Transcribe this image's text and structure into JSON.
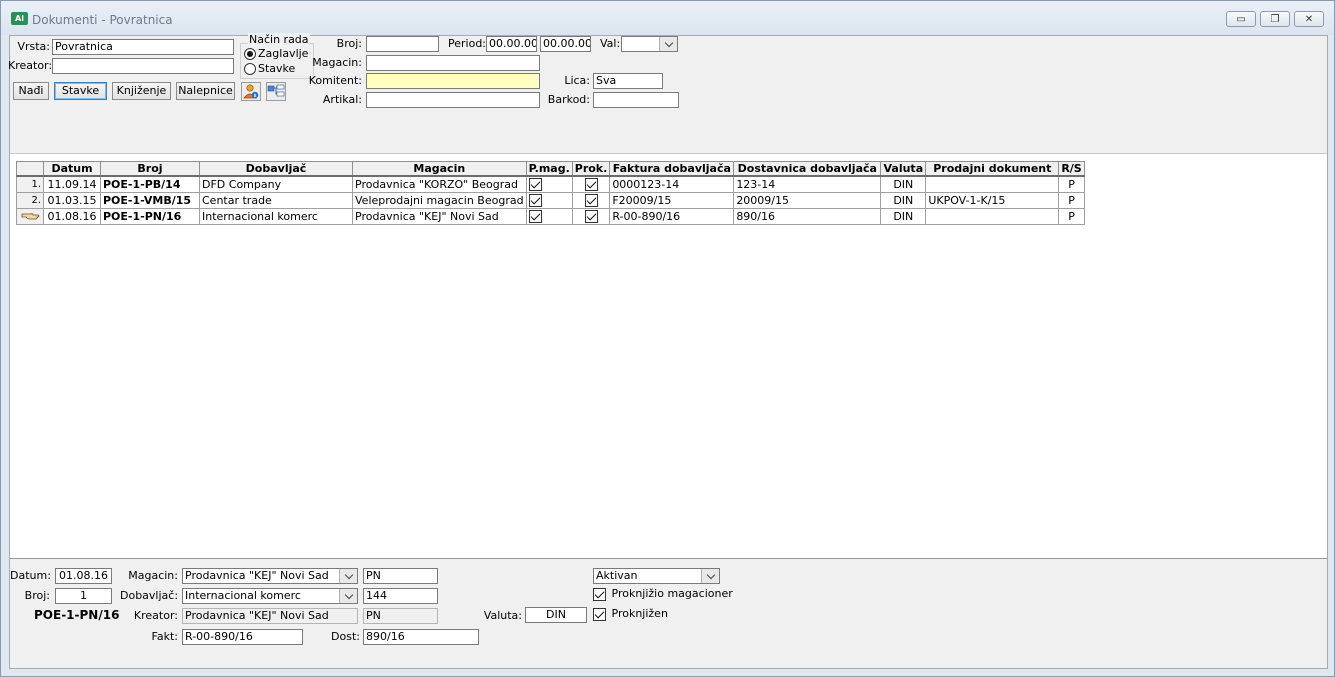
{
  "window": {
    "title": "Dokumenti - Povratnica",
    "app_icon_text": "Al",
    "minimize_glyph": "▭",
    "restore_glyph": "❐",
    "close_glyph": "✕"
  },
  "filter": {
    "vrsta_label": "Vrsta:",
    "vrsta_value": "Povratnica",
    "kreator_label": "Kreator:",
    "kreator_value": "",
    "nacin_rada_title": "Način rada",
    "nacin_options": [
      "Zaglavlje",
      "Stavke"
    ],
    "nacin_selected": "Zaglavlje",
    "broj_label": "Broj:",
    "broj_value": "",
    "period_label": "Period:",
    "period_from": "00.00.00",
    "period_to": "00.00.00",
    "val_label": "Val:",
    "val_value": "",
    "magacin_label": "Magacin:",
    "magacin_value": "",
    "komitent_label": "Komitent:",
    "komitent_value": "",
    "lica_label": "Lica:",
    "lica_value": "Sva",
    "artikal_label": "Artikal:",
    "artikal_value": "",
    "barkod_label": "Barkod:",
    "barkod_value": ""
  },
  "buttons": {
    "nadji": "Nađi",
    "stavke": "Stavke",
    "knjizenje": "Knjiženje",
    "nalepnice": "Nalepnice",
    "icon1": "user-info-icon",
    "icon2": "tree-view-icon"
  },
  "grid": {
    "columns": [
      "Datum",
      "Broj",
      "Dobavljač",
      "Magacin",
      "P.mag.",
      "Prok.",
      "Faktura dobavljača",
      "Dostavnica dobavljača",
      "Valuta",
      "Prodajni dokument",
      "R/S"
    ],
    "rows": [
      {
        "rn": "1.",
        "datum": "11.09.14",
        "broj": "POE-1-PB/14",
        "dobavljac": "DFD Company",
        "magacin": "Prodavnica \"KORZO\" Beograd",
        "pmag": true,
        "prok": true,
        "faktura": "0000123-14",
        "dostavnica": "123-14",
        "valuta": "DIN",
        "prodajni": "",
        "rs": "P"
      },
      {
        "rn": "2.",
        "datum": "01.03.15",
        "broj": "POE-1-VMB/15",
        "dobavljac": "Centar trade",
        "magacin": "Veleprodajni magacin Beograd",
        "pmag": true,
        "prok": true,
        "faktura": "F20009/15",
        "dostavnica": "20009/15",
        "valuta": "DIN",
        "prodajni": "UKPOV-1-K/15",
        "rs": "P"
      },
      {
        "rn": "",
        "datum": "01.08.16",
        "broj": "POE-1-PN/16",
        "dobavljac": "Internacional komerc",
        "magacin": "Prodavnica \"KEJ\" Novi Sad",
        "pmag": true,
        "prok": true,
        "faktura": "R-00-890/16",
        "dostavnica": "890/16",
        "valuta": "DIN",
        "prodajni": "",
        "rs": "P"
      }
    ]
  },
  "detail": {
    "datum_label": "Datum:",
    "datum_value": "01.08.16",
    "broj_label": "Broj:",
    "broj_value": "1",
    "doc_number": "POE-1-PN/16",
    "magacin_label": "Magacin:",
    "magacin_value": "Prodavnica \"KEJ\" Novi Sad",
    "magacin_code": "PN",
    "dobavljac_label": "Dobavljač:",
    "dobavljac_value": "Internacional komerc",
    "dobavljac_code": "144",
    "kreator_label": "Kreator:",
    "kreator_value": "Prodavnica \"KEJ\" Novi Sad",
    "kreator_code": "PN",
    "fakt_label": "Fakt:",
    "fakt_value": "R-00-890/16",
    "dost_label": "Dost:",
    "dost_value": "890/16",
    "status_value": "Aktivan",
    "proknjizio_label": "Proknjižio magacioner",
    "proknjizio_checked": true,
    "valuta_label": "Valuta:",
    "valuta_value": "DIN",
    "proknjizen_label": "Proknjižen",
    "proknjizen_checked": true
  }
}
